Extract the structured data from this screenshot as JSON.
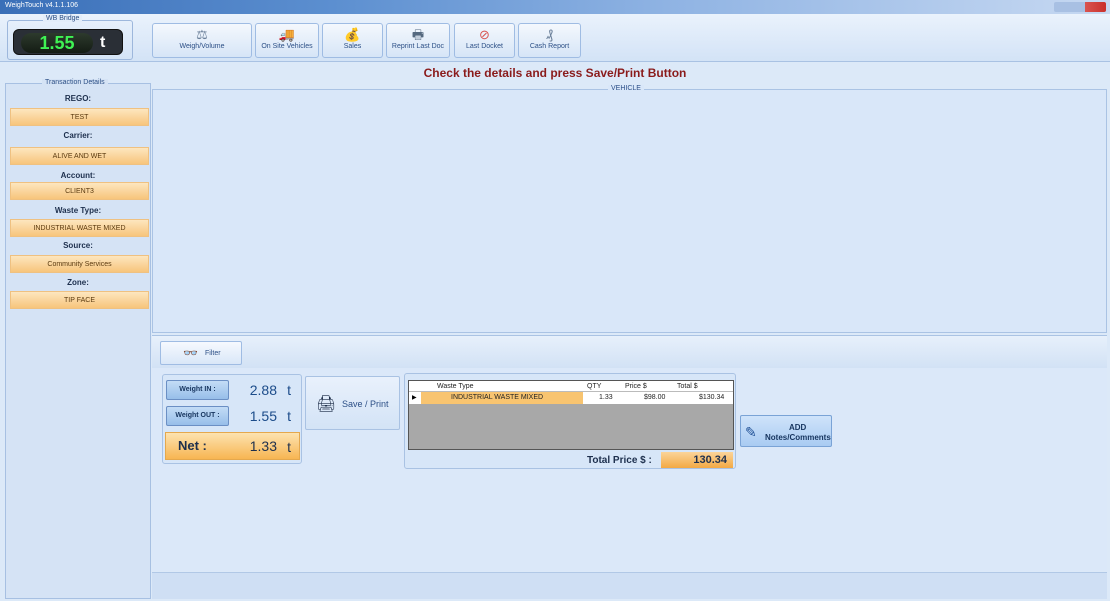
{
  "window": {
    "title": "WeighTouch v4.1.1.106"
  },
  "wb_bridge": {
    "legend": "WB Bridge",
    "value": "1.55",
    "unit": "t"
  },
  "toolbar": {
    "buttons": [
      {
        "label": "Weigh/Volume",
        "icon": "scales-icon"
      },
      {
        "label": "On Site Vehicles",
        "icon": "truck-icon"
      },
      {
        "label": "Sales",
        "icon": "money-bag-icon"
      },
      {
        "label": "Reprint Last Doc",
        "icon": "printer-icon"
      },
      {
        "label": "Last Docket",
        "icon": "no-entry-icon"
      },
      {
        "label": "Cash Report",
        "icon": "cash-report-icon"
      }
    ]
  },
  "banner": "Check the details and press Save/Print Button",
  "transaction": {
    "legend": "Transaction Details",
    "fields": [
      {
        "label": "REGO:",
        "value": "TEST"
      },
      {
        "label": "Carrier:",
        "value": "ALIVE AND WET"
      },
      {
        "label": "Account:",
        "value": "CLIENT3"
      },
      {
        "label": "Waste Type:",
        "value": "INDUSTRIAL WASTE MIXED"
      },
      {
        "label": "Source:",
        "value": "Community Services"
      },
      {
        "label": "Zone:",
        "value": "TIP FACE"
      }
    ]
  },
  "vehicle": {
    "legend": "VEHICLE"
  },
  "filter": {
    "label": "Filter"
  },
  "weights": {
    "in_label": "Weight IN :",
    "in_value": "2.88",
    "in_unit": "t",
    "out_label": "Weight OUT :",
    "out_value": "1.55",
    "out_unit": "t",
    "net_label": "Net :",
    "net_value": "1.33",
    "net_unit": "t"
  },
  "save_print": {
    "label": "Save / Print"
  },
  "items": {
    "columns": [
      "Waste Type",
      "QTY",
      "Price $",
      "Total $"
    ],
    "rows": [
      {
        "waste_type": "INDUSTRIAL WASTE MIXED",
        "qty": "1.33",
        "price": "$98.00",
        "total": "$130.34"
      }
    ],
    "total_label": "Total Price $ :",
    "total_value": "130.34"
  },
  "notes": {
    "line1": "ADD",
    "line2": "Notes/Comments"
  },
  "colors": {
    "accent_orange": "#f7c57c",
    "banner_red": "#8a1b1b",
    "wb_green": "#3ff254"
  }
}
